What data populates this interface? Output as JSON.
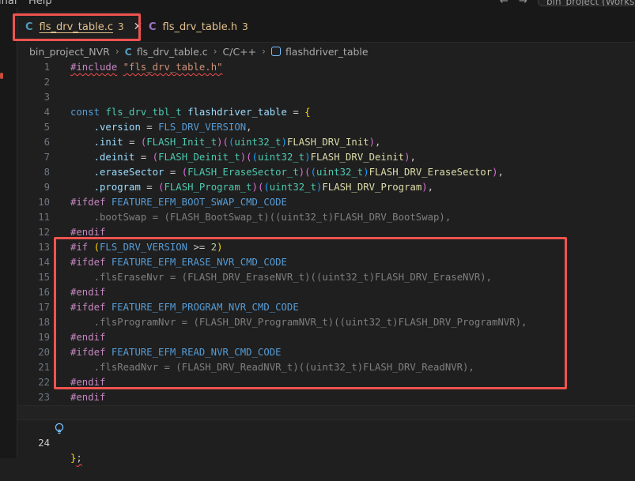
{
  "menubar": {
    "items": [
      "inal",
      "Help"
    ],
    "command_center": "bin_project (Workspace)"
  },
  "tabs": [
    {
      "lang_icon": "C",
      "name": "fls_drv_table.c",
      "problems": "3",
      "active": true
    },
    {
      "lang_icon": "C",
      "name": "fls_drv_table.h",
      "problems": "3",
      "active": false
    }
  ],
  "breadcrumb": {
    "parts": [
      "bin_project_NVR",
      "fls_drv_table.c",
      "C/C++",
      "flashdriver_table"
    ]
  },
  "editor": {
    "line_numbers": [
      "1",
      "2",
      "3",
      "4",
      "5",
      "6",
      "7",
      "8",
      "9",
      "10",
      "11",
      "12",
      "13",
      "14",
      "15",
      "16",
      "17",
      "18",
      "19",
      "20",
      "21",
      "22",
      "23",
      "24"
    ],
    "lines": [
      "#include \"fls_drv_table.h\"",
      "",
      "",
      "const fls_drv_tbl_t flashdriver_table = {",
      "    .version = FLS_DRV_VERSION,",
      "    .init = (FLASH_Init_t)((uint32_t)FLASH_DRV_Init),",
      "    .deinit = (FLASH_Deinit_t)((uint32_t)FLASH_DRV_Deinit),",
      "    .eraseSector = (FLASH_EraseSector_t)((uint32_t)FLASH_DRV_EraseSector),",
      "    .program = (FLASH_Program_t)((uint32_t)FLASH_DRV_Program),",
      "#ifdef FEATURE_EFM_BOOT_SWAP_CMD_CODE",
      "    .bootSwap = (FLASH_BootSwap_t)((uint32_t)FLASH_DRV_BootSwap),",
      "#endif",
      "#if (FLS_DRV_VERSION >= 2)",
      "#ifdef FEATURE_EFM_ERASE_NVR_CMD_CODE",
      "    .flsEraseNvr = (FLASH_DRV_EraseNVR_t)((uint32_t)FLASH_DRV_EraseNVR),",
      "#endif",
      "#ifdef FEATURE_EFM_PROGRAM_NVR_CMD_CODE",
      "    .flsProgramNvr = (FLASH_DRV_ProgramNVR_t)((uint32_t)FLASH_DRV_ProgramNVR),",
      "#endif",
      "#ifdef FEATURE_EFM_READ_NVR_CMD_CODE",
      "    .flsReadNvr = (FLASH_DRV_ReadNVR_t)((uint32_t)FLASH_DRV_ReadNVR),",
      "#endif",
      "#endif",
      "};"
    ],
    "current_line": "24"
  },
  "colors": {
    "highlight_box": "#ef5350",
    "tab_modified_text": "#e2c08d",
    "c_icon": "#519aba",
    "h_icon": "#a074c4"
  },
  "icons": {
    "nav_back": "arrow-left-icon",
    "nav_forward": "arrow-right-icon",
    "close_tab": "close-icon",
    "symbol": "symbol-variable-icon",
    "lightbulb": "lightbulb-icon"
  }
}
